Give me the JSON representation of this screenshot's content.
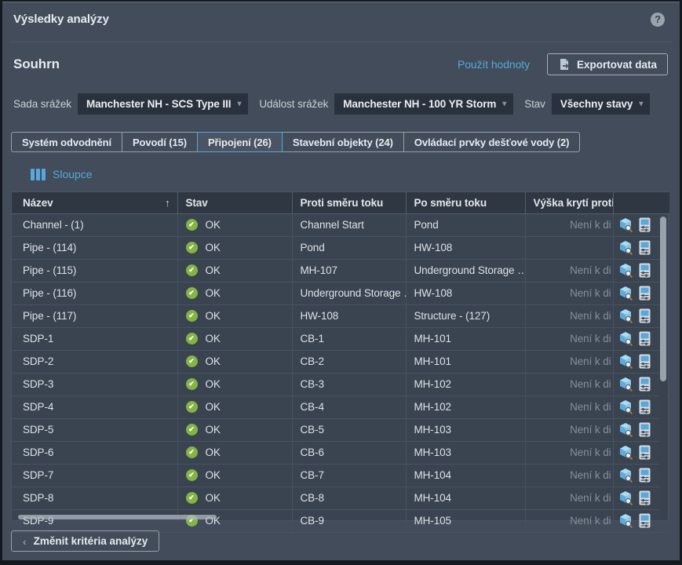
{
  "window": {
    "title": "Výsledky analýzy",
    "help_icon": "question-mark"
  },
  "summary": {
    "heading": "Souhrn",
    "apply_values_link": "Použít hodnoty",
    "export_button_label": "Exportovat data"
  },
  "filters": {
    "rainfall_set": {
      "label": "Sada srážek",
      "value": "Manchester NH - SCS Type III"
    },
    "rainfall_event": {
      "label": "Událost srážek",
      "value": "Manchester NH - 100 YR Storm"
    },
    "status": {
      "label": "Stav",
      "value": "Všechny stavy"
    }
  },
  "tabs": [
    {
      "label": "Systém odvodnění",
      "active": false
    },
    {
      "label": "Povodí (15)",
      "active": false
    },
    {
      "label": "Připojení (26)",
      "active": true
    },
    {
      "label": "Stavební objekty (24)",
      "active": false
    },
    {
      "label": "Ovládací prvky dešťové vody (2)",
      "active": false
    }
  ],
  "toolbar": {
    "columns_button_label": "Sloupce"
  },
  "table": {
    "columns": [
      "Název",
      "Stav",
      "Proti směru toku",
      "Po směru toku",
      "Výška krytí proti"
    ],
    "sorted_by": "Název",
    "sort_direction": "ascending",
    "rows": [
      {
        "name": "Channel - (1)",
        "status": "OK",
        "upstream": "Channel Start",
        "downstream": "Pond",
        "cover": "Není k di"
      },
      {
        "name": "Pipe - (114)",
        "status": "OK",
        "upstream": "Pond",
        "downstream": "HW-108",
        "cover": ""
      },
      {
        "name": "Pipe - (115)",
        "status": "OK",
        "upstream": "MH-107",
        "downstream": "Underground Storage …",
        "cover": "Není k di"
      },
      {
        "name": "Pipe - (116)",
        "status": "OK",
        "upstream": "Underground Storage …",
        "downstream": "HW-108",
        "cover": "Není k di"
      },
      {
        "name": "Pipe - (117)",
        "status": "OK",
        "upstream": "HW-108",
        "downstream": "Structure - (127)",
        "cover": "Není k di"
      },
      {
        "name": "SDP-1",
        "status": "OK",
        "upstream": "CB-1",
        "downstream": "MH-101",
        "cover": "Není k di"
      },
      {
        "name": "SDP-2",
        "status": "OK",
        "upstream": "CB-2",
        "downstream": "MH-101",
        "cover": "Není k di"
      },
      {
        "name": "SDP-3",
        "status": "OK",
        "upstream": "CB-3",
        "downstream": "MH-102",
        "cover": "Není k di"
      },
      {
        "name": "SDP-4",
        "status": "OK",
        "upstream": "CB-4",
        "downstream": "MH-102",
        "cover": "Není k di"
      },
      {
        "name": "SDP-5",
        "status": "OK",
        "upstream": "CB-5",
        "downstream": "MH-103",
        "cover": "Není k di"
      },
      {
        "name": "SDP-6",
        "status": "OK",
        "upstream": "CB-6",
        "downstream": "MH-103",
        "cover": "Není k di"
      },
      {
        "name": "SDP-7",
        "status": "OK",
        "upstream": "CB-7",
        "downstream": "MH-104",
        "cover": "Není k di"
      },
      {
        "name": "SDP-8",
        "status": "OK",
        "upstream": "CB-8",
        "downstream": "MH-104",
        "cover": "Není k di"
      },
      {
        "name": "SDP-9",
        "status": "OK",
        "upstream": "CB-9",
        "downstream": "MH-105",
        "cover": "Není k di"
      }
    ]
  },
  "footer": {
    "back_button_label": "Změnit kritéria analýzy"
  },
  "colors": {
    "accent_blue": "#57a8dc",
    "status_ok_green": "#84b445",
    "panel_bg": "#424c5a",
    "row_bg": "#3a4350",
    "header_bg": "#2f3742",
    "muted_text": "#858e9a"
  }
}
